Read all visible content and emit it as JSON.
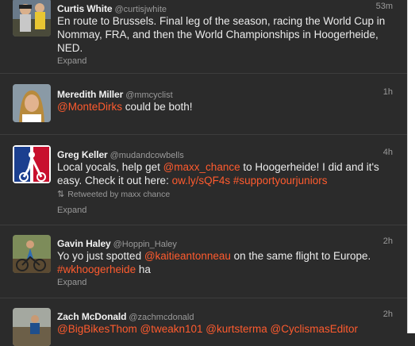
{
  "colors": {
    "background": "#2b2b2b",
    "accent": "#ff5b2e",
    "muted": "#9a9a9a"
  },
  "tweets": [
    {
      "name": "Curtis White",
      "handle": "@curtisjwhite",
      "time": "53m",
      "parts": [
        {
          "type": "text",
          "value": "En route to Brussels. Final leg of the season, racing the World Cup in Nommay, FRA, and then the World Championships in Hoogerheide, NED."
        }
      ],
      "expand": "Expand",
      "avatar_icon": "cyclists-photo-icon"
    },
    {
      "name": "Meredith Miller",
      "handle": "@mmcyclist",
      "time": "1h",
      "parts": [
        {
          "type": "mention",
          "value": "@MonteDirks"
        },
        {
          "type": "text",
          "value": " could be both!"
        }
      ],
      "avatar_icon": "portrait-photo-icon"
    },
    {
      "name": "Greg Keller",
      "handle": "@mudandcowbells",
      "time": "4h",
      "parts": [
        {
          "type": "text",
          "value": "Local yocals, help get "
        },
        {
          "type": "mention",
          "value": "@maxx_chance"
        },
        {
          "type": "text",
          "value": " to Hoogerheide! I did and it's easy. Check it out here: "
        },
        {
          "type": "link",
          "value": "ow.ly/sQF4s"
        },
        {
          "type": "text",
          "value": " "
        },
        {
          "type": "tag",
          "value": "#supportyourjuniors"
        }
      ],
      "retweet": "Retweeted by maxx chance",
      "expand": "Expand",
      "avatar_icon": "cyclocross-logo-icon"
    },
    {
      "name": "Gavin Haley",
      "handle": "@Hoppin_Haley",
      "time": "2h",
      "parts": [
        {
          "type": "text",
          "value": "Yo yo just spotted "
        },
        {
          "type": "mention",
          "value": "@kaitieantonneau"
        },
        {
          "type": "text",
          "value": " on the same flight to Europe. "
        },
        {
          "type": "tag",
          "value": "#wkhoogerheide"
        },
        {
          "type": "text",
          "value": " ha"
        }
      ],
      "expand": "Expand",
      "avatar_icon": "rider-photo-icon"
    },
    {
      "name": "Zach McDonald",
      "handle": "@zachmcdonald",
      "time": "2h",
      "parts": [
        {
          "type": "mention",
          "value": "@BigBikesThom"
        },
        {
          "type": "text",
          "value": " "
        },
        {
          "type": "mention",
          "value": "@tweakn101"
        },
        {
          "type": "text",
          "value": " "
        },
        {
          "type": "mention",
          "value": "@kurtsterma"
        },
        {
          "type": "text",
          "value": " "
        },
        {
          "type": "mention",
          "value": "@CyclismasEditor"
        }
      ],
      "avatar_icon": "race-photo-icon"
    }
  ]
}
